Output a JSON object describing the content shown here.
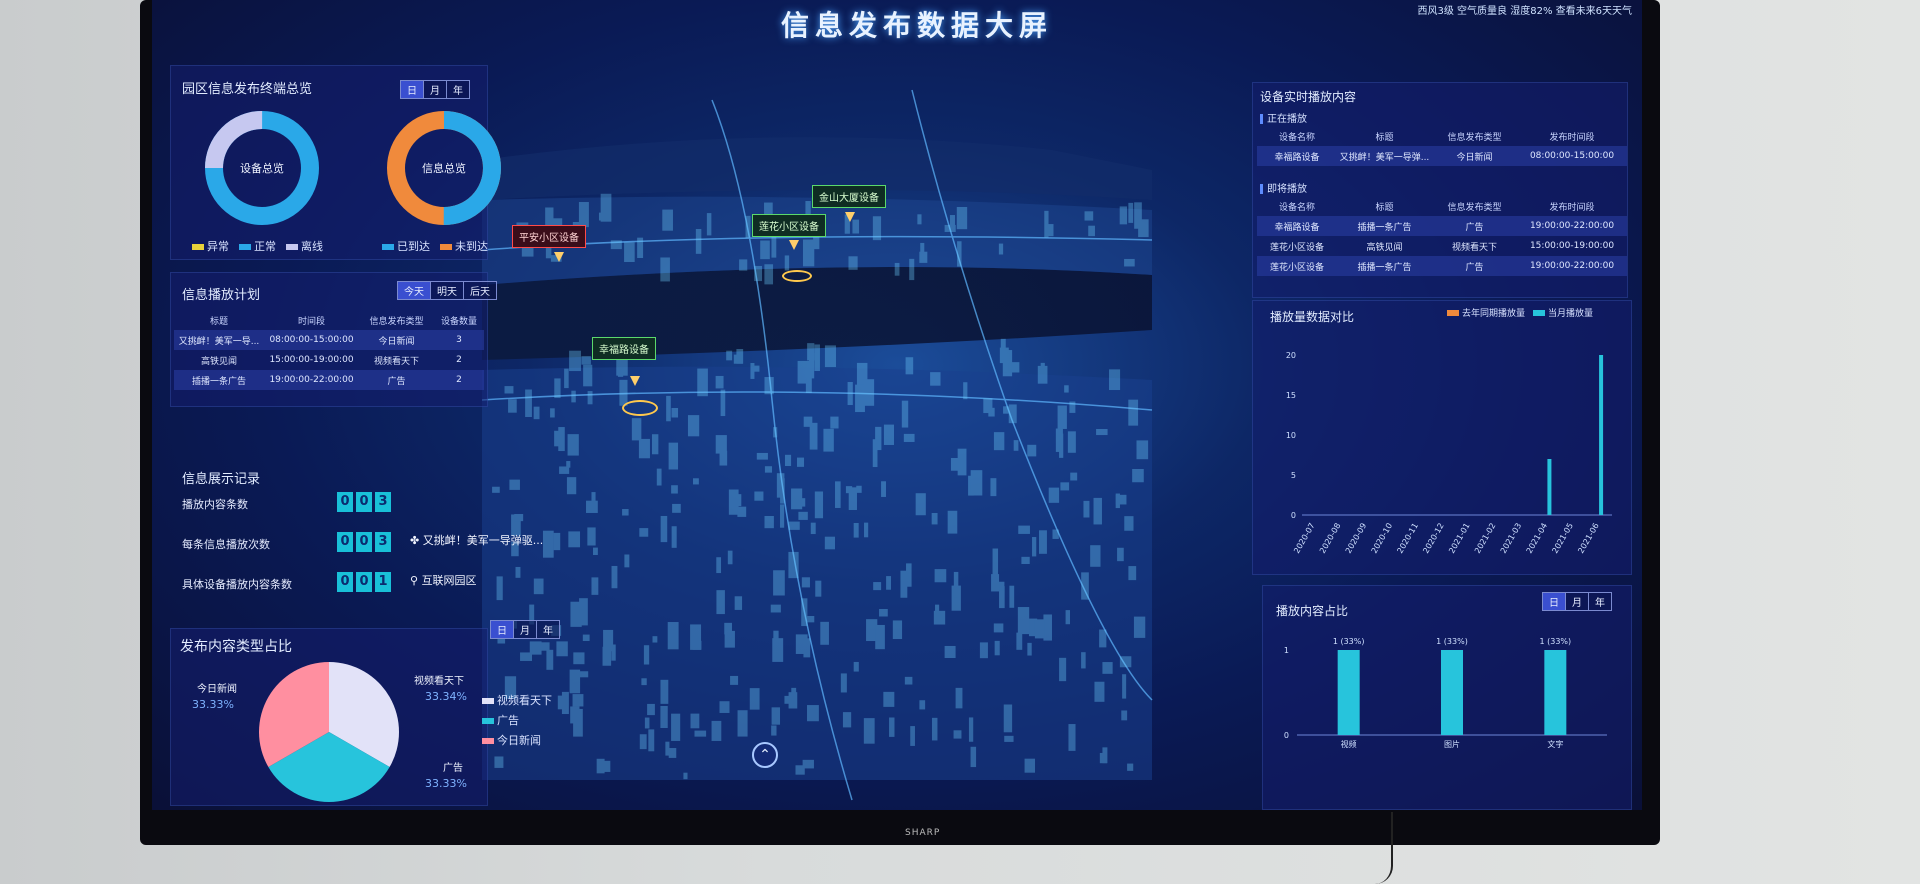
{
  "header": {
    "title": "信息发布数据大屏",
    "weather": "西风3级 空气质量良 湿度82% 查看未来6天天气"
  },
  "overview": {
    "title": "园区信息发布终端总览",
    "range": [
      "日",
      "月",
      "年"
    ],
    "donut1_label": "设备总览",
    "donut2_label": "信息总览",
    "legend1": [
      {
        "label": "异常",
        "color": "#e8d13a"
      },
      {
        "label": "正常",
        "color": "#2aa8e8"
      },
      {
        "label": "离线",
        "color": "#c6c8f0"
      }
    ],
    "legend2": [
      {
        "label": "已到达",
        "color": "#2aa8e8"
      },
      {
        "label": "未到达",
        "color": "#f08a3c"
      }
    ]
  },
  "plan": {
    "title": "信息播放计划",
    "days": [
      "今天",
      "明天",
      "后天"
    ],
    "headers": [
      "标题",
      "时间段",
      "信息发布类型",
      "设备数量"
    ],
    "rows": [
      [
        "又挑衅！美军一导...",
        "08:00:00-15:00:00",
        "今日新闻",
        "3"
      ],
      [
        "高铁见闻",
        "15:00:00-19:00:00",
        "视频看天下",
        "2"
      ],
      [
        "插播一条广告",
        "19:00:00-22:00:00",
        "广告",
        "2"
      ]
    ]
  },
  "records": {
    "title": "信息展示记录",
    "items": [
      {
        "label": "播放内容条数",
        "digits": [
          "0",
          "0",
          "3"
        ],
        "extra": ""
      },
      {
        "label": "每条信息播放次数",
        "digits": [
          "0",
          "0",
          "3"
        ],
        "extra": "又挑衅！美军一导弹驱..."
      },
      {
        "label": "具体设备播放内容条数",
        "digits": [
          "0",
          "0",
          "1"
        ],
        "extra": "互联网园区"
      }
    ]
  },
  "types": {
    "title": "发布内容类型占比",
    "range": [
      "日",
      "月",
      "年"
    ],
    "labels": [
      {
        "name": "今日新闻",
        "value": "33.33%"
      },
      {
        "name": "视频看天下",
        "value": "33.34%"
      },
      {
        "name": "广告",
        "value": "33.33%"
      }
    ],
    "legend": [
      {
        "label": "视频看天下",
        "color": "#e2e2f8"
      },
      {
        "label": "广告",
        "color": "#27c4dc"
      },
      {
        "label": "今日新闻",
        "color": "#ff8fa0"
      }
    ]
  },
  "realtime": {
    "title": "设备实时播放内容",
    "now_label": "正在播放",
    "headers": [
      "设备名称",
      "标题",
      "信息发布类型",
      "发布时间段"
    ],
    "now_rows": [
      [
        "幸福路设备",
        "又挑衅！美军一导弹...",
        "今日新闻",
        "08:00:00-15:00:00"
      ]
    ],
    "next_label": "即将播放",
    "next_rows": [
      [
        "幸福路设备",
        "插播一条广告",
        "广告",
        "19:00:00-22:00:00"
      ],
      [
        "莲花小区设备",
        "高铁见闻",
        "视频看天下",
        "15:00:00-19:00:00"
      ],
      [
        "莲花小区设备",
        "插播一条广告",
        "广告",
        "19:00:00-22:00:00"
      ]
    ]
  },
  "compare": {
    "title": "播放量数据对比",
    "legend": [
      {
        "label": "去年同期播放量",
        "color": "#f08a3c"
      },
      {
        "label": "当月播放量",
        "color": "#27c4dc"
      }
    ]
  },
  "ratio": {
    "title": "播放内容占比",
    "range": [
      "日",
      "月",
      "年"
    ]
  },
  "map": {
    "markers": [
      {
        "label": "平安小区设备",
        "style": "red"
      },
      {
        "label": "莲花小区设备",
        "style": "green"
      },
      {
        "label": "金山大厦设备",
        "style": "green"
      },
      {
        "label": "幸福路设备",
        "style": "green"
      }
    ]
  },
  "chart_data": [
    {
      "type": "bar",
      "title": "播放量数据对比",
      "categories": [
        "2020-07",
        "2020-08",
        "2020-09",
        "2020-10",
        "2020-11",
        "2020-12",
        "2021-01",
        "2021-02",
        "2021-03",
        "2021-04",
        "2021-05",
        "2021-06"
      ],
      "series": [
        {
          "name": "去年同期播放量",
          "values": [
            0,
            0,
            0,
            0,
            0,
            0,
            0,
            0,
            0,
            0,
            0,
            0
          ]
        },
        {
          "name": "当月播放量",
          "values": [
            0,
            0,
            0,
            0,
            0,
            0,
            0,
            0,
            0,
            7,
            0,
            20
          ]
        }
      ],
      "yticks": [
        0,
        5,
        10,
        15,
        20
      ],
      "ylim": [
        0,
        20
      ]
    },
    {
      "type": "bar",
      "title": "播放内容占比",
      "categories": [
        "视频",
        "图片",
        "文字"
      ],
      "values": [
        1,
        1,
        1
      ],
      "data_labels": [
        "1 (33%)",
        "1 (33%)",
        "1 (33%)"
      ],
      "yticks": [
        0,
        1
      ],
      "ylim": [
        0,
        1
      ]
    },
    {
      "type": "pie",
      "title": "发布内容类型占比",
      "categories": [
        "视频看天下",
        "广告",
        "今日新闻"
      ],
      "values": [
        33.34,
        33.33,
        33.33
      ]
    },
    {
      "type": "pie",
      "title": "设备总览",
      "categories": [
        "正常",
        "离线"
      ],
      "values": [
        75,
        25
      ]
    },
    {
      "type": "pie",
      "title": "信息总览",
      "categories": [
        "已到达",
        "未到达"
      ],
      "values": [
        50,
        50
      ]
    }
  ]
}
